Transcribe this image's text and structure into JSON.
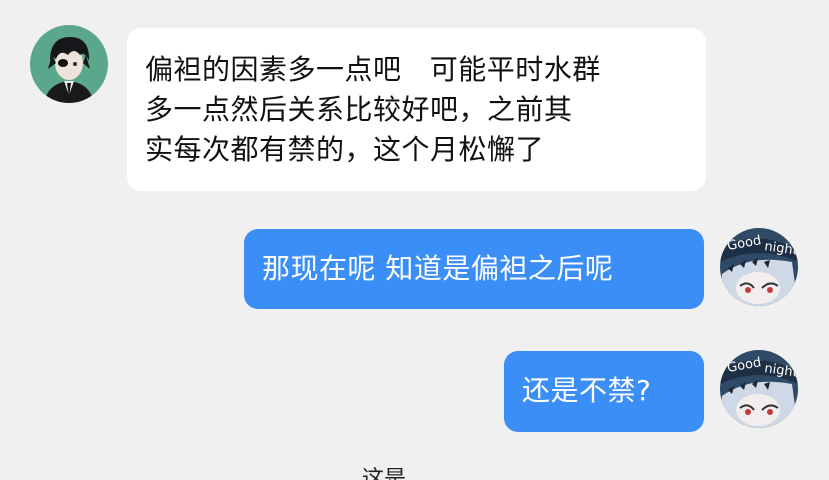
{
  "messages": [
    {
      "direction": "incoming",
      "lines": [
        "偏袒的因素多一点吧   可能平时水群",
        "多一点然后关系比较好吧，之前其",
        "实每次都有禁的，这个月松懈了"
      ],
      "avatar_icon": "dark-hair-boy-avatar"
    },
    {
      "direction": "outgoing",
      "lines": [
        "那现在呢 知道是偏袒之后呢"
      ],
      "avatar_icon": "good-night-girl-avatar"
    },
    {
      "direction": "outgoing",
      "lines": [
        "还是不禁?"
      ],
      "avatar_icon": "good-night-girl-avatar"
    }
  ],
  "partial_text": "这是",
  "colors": {
    "background": "#f0f0f0",
    "incoming_bubble": "#ffffff",
    "outgoing_bubble": "#3a8ef6"
  }
}
